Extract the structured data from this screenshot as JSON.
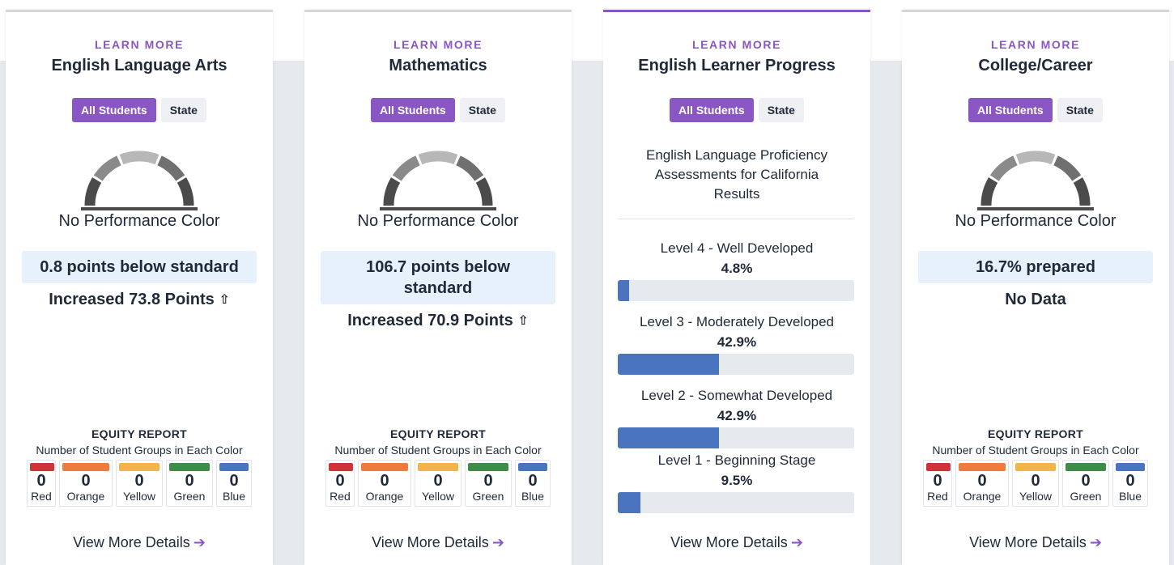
{
  "colors": {
    "accent": "#8a56c4",
    "metric_bg": "#e7f1fc",
    "bar_fill": "#4a74c0",
    "equity": {
      "red": "#d0323a",
      "orange": "#ef7b3d",
      "yellow": "#f3b54b",
      "green": "#3f8b48",
      "blue": "#4a74c0"
    }
  },
  "cards": [
    {
      "learn_more": "LEARN MORE",
      "title": "English Language Arts",
      "toggle": {
        "all_students": "All Students",
        "state": "State"
      },
      "performance": "No Performance Color",
      "metric": "0.8 points below standard",
      "change": "Increased 73.8 Points",
      "equity": {
        "title": "EQUITY REPORT",
        "subtitle": "Number of Student Groups in Each Color",
        "items": [
          {
            "count": "0",
            "label": "Red"
          },
          {
            "count": "0",
            "label": "Orange"
          },
          {
            "count": "0",
            "label": "Yellow"
          },
          {
            "count": "0",
            "label": "Green"
          },
          {
            "count": "0",
            "label": "Blue"
          }
        ]
      },
      "details": "View More Details"
    },
    {
      "learn_more": "LEARN MORE",
      "title": "Mathematics",
      "toggle": {
        "all_students": "All Students",
        "state": "State"
      },
      "performance": "No Performance Color",
      "metric_line1": "106.7 points below",
      "metric_line2": "standard",
      "change": "Increased 70.9 Points",
      "equity": {
        "title": "EQUITY REPORT",
        "subtitle": "Number of Student Groups in Each Color",
        "items": [
          {
            "count": "0",
            "label": "Red"
          },
          {
            "count": "0",
            "label": "Orange"
          },
          {
            "count": "0",
            "label": "Yellow"
          },
          {
            "count": "0",
            "label": "Green"
          },
          {
            "count": "0",
            "label": "Blue"
          }
        ]
      },
      "details": "View More Details"
    },
    {
      "learn_more": "LEARN MORE",
      "title": "English Learner Progress",
      "toggle": {
        "all_students": "All Students",
        "state": "State"
      },
      "description_lines": [
        "English Language Proficiency",
        "Assessments for California",
        "Results"
      ],
      "levels": [
        {
          "name": "Level 4 - Well Developed",
          "percent": "4.8%",
          "value": 4.8
        },
        {
          "name": "Level 3 - Moderately Developed",
          "percent": "42.9%",
          "value": 42.9
        },
        {
          "name": "Level 2 - Somewhat Developed",
          "percent": "42.9%",
          "value": 42.9
        },
        {
          "name": "Level 1 - Beginning Stage",
          "percent": "9.5%",
          "value": 9.5
        }
      ],
      "details": "View More Details"
    },
    {
      "learn_more": "LEARN MORE",
      "title": "College/Career",
      "toggle": {
        "all_students": "All Students",
        "state": "State"
      },
      "performance": "No Performance Color",
      "metric": "16.7% prepared",
      "change": "No Data",
      "equity": {
        "title": "EQUITY REPORT",
        "subtitle": "Number of Student Groups in Each Color",
        "items": [
          {
            "count": "0",
            "label": "Red"
          },
          {
            "count": "0",
            "label": "Orange"
          },
          {
            "count": "0",
            "label": "Yellow"
          },
          {
            "count": "0",
            "label": "Green"
          },
          {
            "count": "0",
            "label": "Blue"
          }
        ]
      },
      "details": "View More Details"
    }
  ]
}
